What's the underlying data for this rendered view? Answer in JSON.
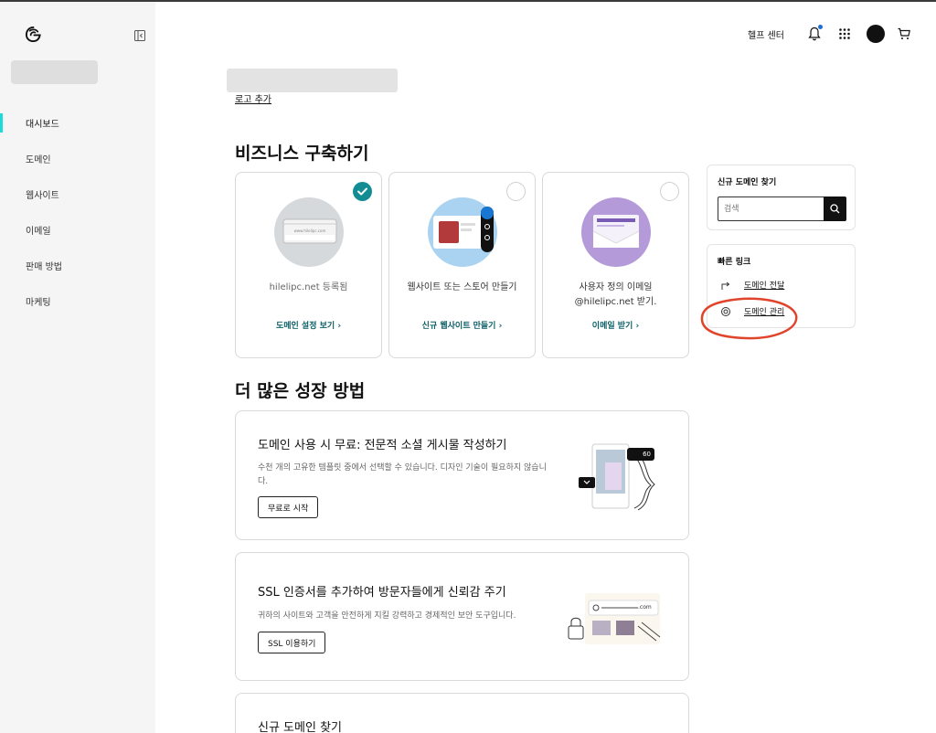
{
  "header": {
    "help_label": "헬프 센터"
  },
  "sidebar": {
    "items": [
      {
        "label": "대시보드",
        "active": true
      },
      {
        "label": "도메인"
      },
      {
        "label": "웹사이트"
      },
      {
        "label": "이메일"
      },
      {
        "label": "판매 방법"
      },
      {
        "label": "마케팅"
      }
    ]
  },
  "main": {
    "add_logo_link": "로고 추가",
    "build_heading": "비즈니스 구축하기",
    "cards": [
      {
        "desc": "hilelipc.net 등록됨",
        "cta": "도메인 설정 보기 ›",
        "completed": true,
        "mock_domain": "www.hilelipc.com"
      },
      {
        "desc": "웹사이트 또는 스토어 만들기",
        "cta": "신규 웹사이트 만들기 ›",
        "completed": false
      },
      {
        "desc": "사용자 정의 이메일 @hilelipc.net 받기.",
        "cta": "이메일 받기 ›",
        "completed": false
      }
    ],
    "grow_heading": "더 많은 성장 방법",
    "promos": [
      {
        "title": "도메인 사용 시 무료: 전문적 소셜 게시물 작성하기",
        "sub": "수천 개의 고유한 템플릿 중에서 선택할 수 있습니다. 디자인 기술이 필요하지 않습니다.",
        "button": "무료로 시작",
        "badge": "60"
      },
      {
        "title": "SSL 인증서를 추가하여 방문자들에게 신뢰감 주기",
        "sub": "귀하의 사이트와 고객을 안전하게 지킬 강력하고 경제적인 보안 도구입니다.",
        "button": "SSL 이용하기",
        "domain_tag": ".com"
      },
      {
        "title": "신규 도메인 찾기"
      }
    ]
  },
  "right_panel": {
    "find_domain_title": "신규 도메인 찾기",
    "search_placeholder": "검색",
    "quick_links_title": "빠른 링크",
    "quick_links": [
      {
        "label": "도메인 전달",
        "icon": "forward-arrow-icon"
      },
      {
        "label": "도메인 관리",
        "icon": "target-icon"
      }
    ]
  },
  "colors": {
    "accent": "#1bdbdb",
    "check": "#138d93",
    "cta": "#0b5f66",
    "annotation": "#e0452c"
  }
}
